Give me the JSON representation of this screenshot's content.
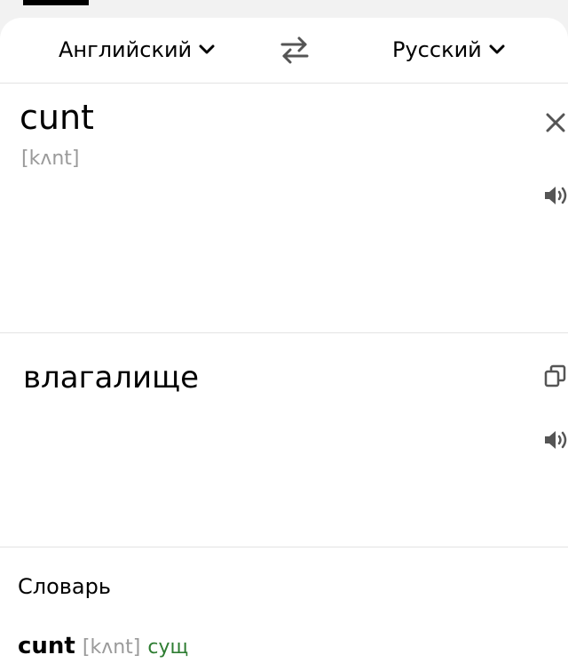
{
  "languages": {
    "source": "Английский",
    "target": "Русский"
  },
  "source_panel": {
    "text": "cunt",
    "transcription": "[kʌnt]"
  },
  "target_panel": {
    "text": "влагалище"
  },
  "dictionary": {
    "title": "Словарь",
    "entry": {
      "word": "cunt",
      "transcription": "[kʌnt]",
      "part_of_speech": "сущ"
    }
  },
  "icons": {
    "lang_chevron": "chevron-down-icon",
    "swap": "swap-arrows-icon",
    "clear": "close-icon",
    "speak": "speaker-icon",
    "copy": "copy-icon"
  },
  "colors": {
    "muted_text": "#9a9a9a",
    "part_of_speech": "#2e7d32",
    "divider": "#e3e3e3",
    "icon": "#555555"
  }
}
